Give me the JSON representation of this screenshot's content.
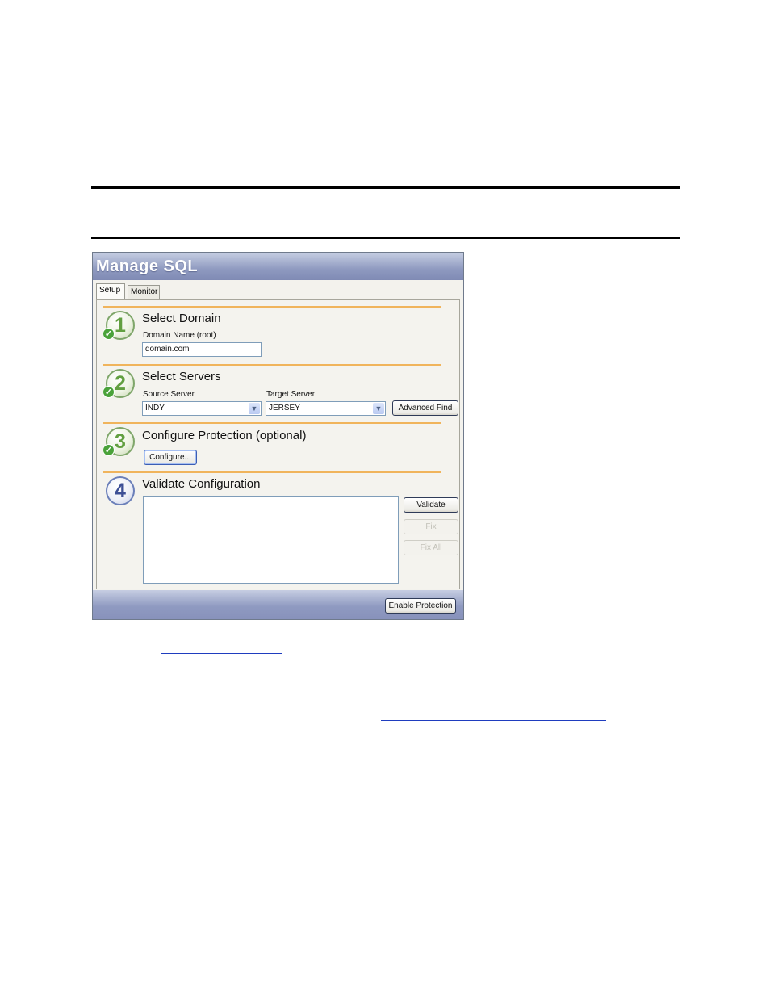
{
  "window": {
    "title": "Manage SQL"
  },
  "tabs": [
    {
      "label": "Setup",
      "active": true
    },
    {
      "label": "Monitor",
      "active": false
    }
  ],
  "steps": {
    "domain": {
      "number": "1",
      "title": "Select Domain",
      "field_label": "Domain Name (root)",
      "field_value": "domain.com",
      "completed": true
    },
    "servers": {
      "number": "2",
      "title": "Select Servers",
      "source_label": "Source Server",
      "source_value": "INDY",
      "target_label": "Target Server",
      "target_value": "JERSEY",
      "advanced_find_label": "Advanced Find",
      "completed": true
    },
    "protection": {
      "number": "3",
      "title": "Configure Protection (optional)",
      "configure_label": "Configure...",
      "completed": true
    },
    "validate": {
      "number": "4",
      "title": "Validate Configuration",
      "validate_label": "Validate",
      "fix_label": "Fix",
      "fix_all_label": "Fix All",
      "completed": false
    }
  },
  "footer": {
    "enable_protection_label": "Enable Protection"
  },
  "colors": {
    "title_bar": "#8f9ac0",
    "separator": "#f0b45c",
    "step_done": "#62a041",
    "step_pending": "#3d4f96"
  },
  "icons": {
    "step_complete": "check-icon",
    "combo_arrow": "chevron-down-icon"
  }
}
